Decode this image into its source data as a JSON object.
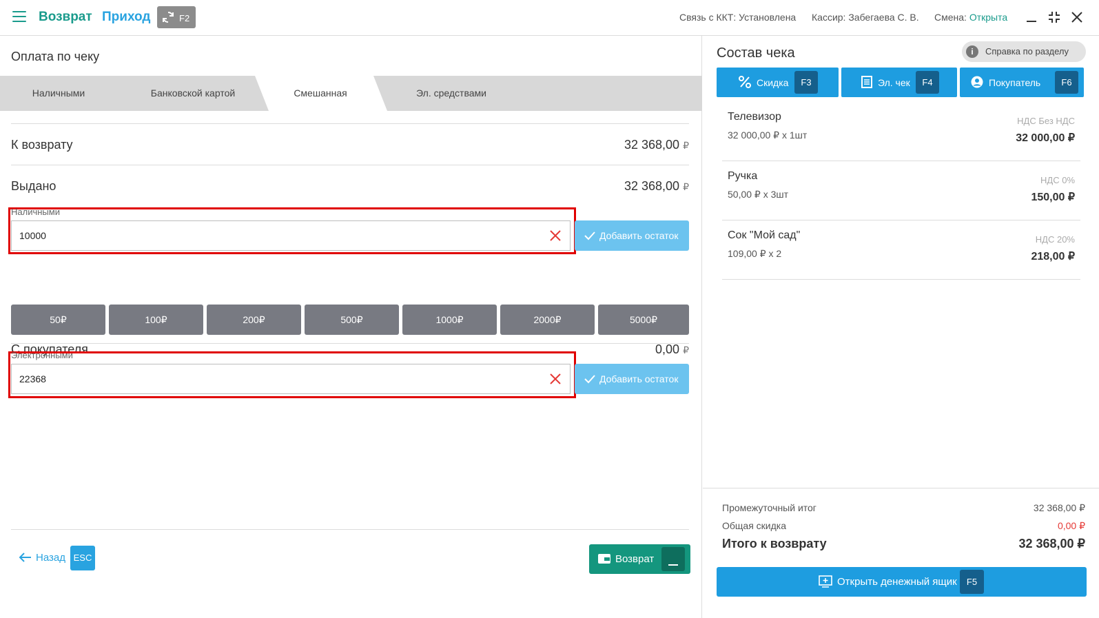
{
  "header": {
    "mode_return": "Возврат",
    "mode_income": "Приход",
    "sync_key": "F2",
    "kkt_status": "Связь с ККТ: Установлена",
    "cashier": "Кассир: Забегаева С. В.",
    "shift_label": "Смена:",
    "shift_value": "Открыта"
  },
  "payment": {
    "title": "Оплата по чеку",
    "tabs": [
      "Наличными",
      "Банковской картой",
      "Смешанная",
      "Эл. средствами"
    ],
    "active_tab": "Смешанная",
    "to_return_label": "К возврату",
    "to_return_value": "32 368,00",
    "issued_label": "Выдано",
    "issued_value": "32 368,00",
    "currency": "₽",
    "cash_label": "Наличными",
    "cash_value": "10000",
    "add_rest_label": "Добавить остаток",
    "bills": [
      "50₽",
      "100₽",
      "200₽",
      "500₽",
      "1000₽",
      "2000₽",
      "5000₽"
    ],
    "from_buyer_label": "С покупателя",
    "from_buyer_value": "0,00",
    "electronic_label": "Электронными",
    "electronic_value": "22368",
    "back_label": "Назад",
    "back_key": "ESC",
    "return_button": "Возврат"
  },
  "receipt": {
    "title": "Состав чека",
    "help_label": "Справка по разделу",
    "actions": [
      {
        "label": "Скидка",
        "key": "F3"
      },
      {
        "label": "Эл. чек",
        "key": "F4"
      },
      {
        "label": "Покупатель",
        "key": "F6"
      }
    ],
    "items": [
      {
        "name": "Телевизор",
        "qty": "32 000,00 ₽ x 1шт",
        "vat": "НДС Без НДС",
        "sum": "32 000,00 ₽"
      },
      {
        "name": "Ручка",
        "qty": "50,00 ₽ x 3шт",
        "vat": "НДС 0%",
        "sum": "150,00 ₽"
      },
      {
        "name": "Сок \"Мой сад\"",
        "qty": "109,00 ₽ x 2",
        "vat": "НДС 20%",
        "sum": "218,00 ₽"
      }
    ],
    "subtotal_label": "Промежуточный итог",
    "subtotal_value": "32 368,00 ₽",
    "discount_label": "Общая скидка",
    "discount_value": "0,00 ₽",
    "total_label": "Итого к возврату",
    "total_value": "32 368,00 ₽",
    "drawer_label": "Открыть денежный ящик",
    "drawer_key": "F5"
  },
  "colors": {
    "brand_green": "#1a9b8c",
    "brand_blue": "#1e9de0",
    "discount_red": "#e53935",
    "highlight_red": "#e00000"
  }
}
